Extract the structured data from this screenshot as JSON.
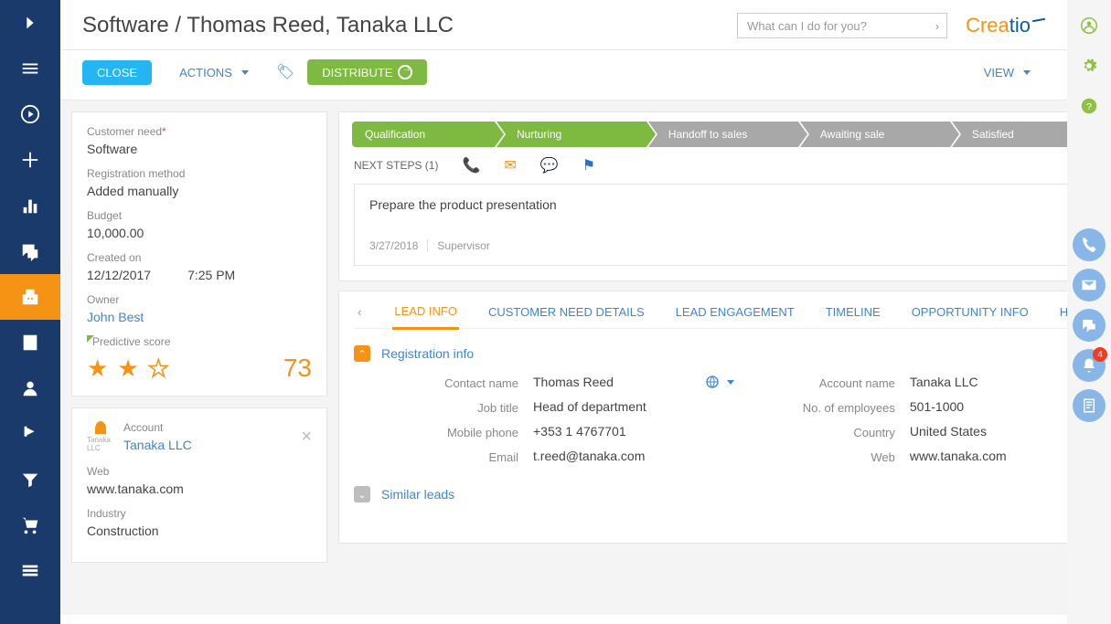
{
  "header": {
    "title": "Software / Thomas Reed, Tanaka LLC",
    "search_placeholder": "What can I do for you?",
    "brand": "Creatio"
  },
  "toolbar": {
    "close": "CLOSE",
    "actions": "ACTIONS",
    "distribute": "DISTRIBUTE",
    "view": "VIEW"
  },
  "leftPanel": {
    "customer_need_label": "Customer need",
    "customer_need": "Software",
    "reg_method_label": "Registration method",
    "reg_method": "Added manually",
    "budget_label": "Budget",
    "budget": "10,000.00",
    "created_label": "Created on",
    "created_date": "12/12/2017",
    "created_time": "7:25 PM",
    "owner_label": "Owner",
    "owner": "John Best",
    "pred_label": "Predictive score",
    "pred_score": "73",
    "account_label": "Account",
    "account_name": "Tanaka LLC",
    "web_label": "Web",
    "web": "www.tanaka.com",
    "industry_label": "Industry",
    "industry": "Construction"
  },
  "stages": {
    "s1": "Qualification",
    "s2": "Nurturing",
    "s3": "Handoff to sales",
    "s4": "Awaiting sale",
    "s5": "Satisfied"
  },
  "nextSteps": {
    "label": "NEXT STEPS (1)",
    "task_title": "Prepare the product presentation",
    "task_date": "3/27/2018",
    "task_user": "Supervisor"
  },
  "tabs": {
    "t1": "LEAD INFO",
    "t2": "CUSTOMER NEED DETAILS",
    "t3": "LEAD ENGAGEMENT",
    "t4": "TIMELINE",
    "t5": "OPPORTUNITY INFO",
    "t6": "HIS"
  },
  "regInfo": {
    "title": "Registration info",
    "contact_name_l": "Contact name",
    "contact_name": "Thomas Reed",
    "account_name_l": "Account name",
    "account_name": "Tanaka LLC",
    "job_l": "Job title",
    "job": "Head of department",
    "emp_l": "No. of employees",
    "emp": "501-1000",
    "mobile_l": "Mobile phone",
    "mobile": "+353 1 4767701",
    "country_l": "Country",
    "country": "United States",
    "email_l": "Email",
    "email": "t.reed@tanaka.com",
    "web_l": "Web",
    "web": "www.tanaka.com"
  },
  "similar": {
    "title": "Similar leads"
  },
  "rightRail": {
    "badge": "4"
  }
}
